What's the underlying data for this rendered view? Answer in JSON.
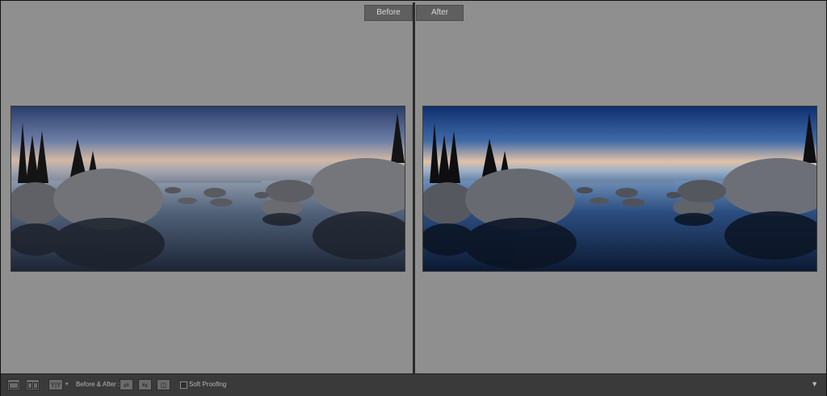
{
  "panes": {
    "before_label": "Before",
    "after_label": "After"
  },
  "toolbar": {
    "yy_label": "Y|Y",
    "before_after_label": "Before & After :",
    "soft_proofing_label": "Soft Proofing",
    "soft_proofing_checked": false
  },
  "colors": {
    "panel_gray": "#8f8f8f",
    "toolbar_bg": "#3a3a3a",
    "label_bg": "#5f5f5f"
  },
  "icons": {
    "loupe_view": "rectangle-icon",
    "compare_layout": "split-icon",
    "swap": "swap-icon",
    "copy": "copy-icon",
    "toggle": "toggle-icon",
    "menu": "chevron-down-icon"
  }
}
